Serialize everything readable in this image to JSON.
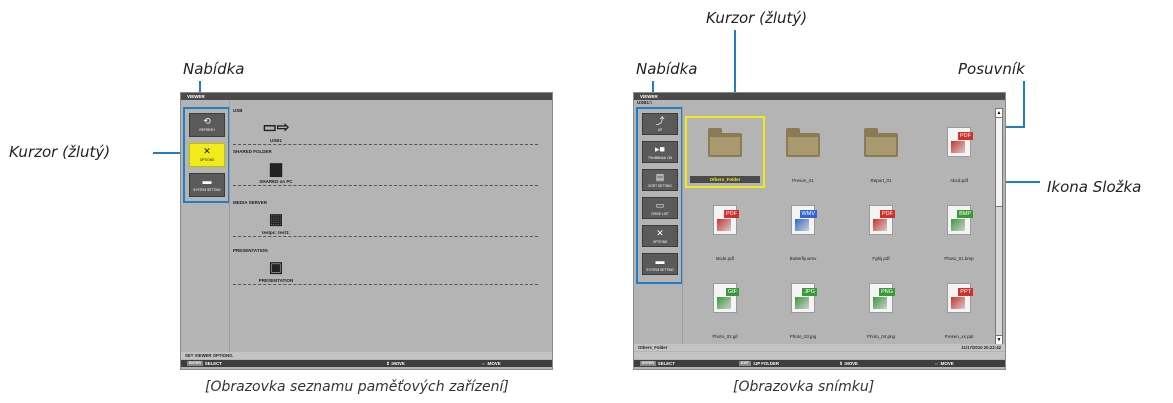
{
  "annotations": {
    "left_menu_label": "Nabídka",
    "left_cursor_label": "Kurzor (žlutý)",
    "right_cursor_label": "Kurzor (žlutý)",
    "right_menu_label": "Nabídka",
    "scrollbar_label": "Posuvník",
    "folder_icon_label": "Ikona Složka"
  },
  "captions": {
    "left": "[Obrazovka seznamu paměťových zařízení]",
    "right": "[Obrazovka snímku]"
  },
  "left_screen": {
    "title": "VIEWER",
    "menu": [
      {
        "icon": "refresh-icon",
        "glyph": "⟲",
        "label": "REFRESH",
        "selected": false
      },
      {
        "icon": "tools-icon",
        "glyph": "✕",
        "label": "OPTIONS",
        "selected": true
      },
      {
        "icon": "system-setting-icon",
        "glyph": "▬",
        "label": "SYSTEM SETTING",
        "selected": false
      }
    ],
    "sections": [
      {
        "header": "USB",
        "device": "USB1",
        "icon": "usb-icon",
        "glyph": "▭⇨"
      },
      {
        "header": "SHARED FOLDER",
        "device": "SHARED on PC",
        "icon": "shared-folder-icon",
        "glyph": "▆"
      },
      {
        "header": "MEDIA SERVER",
        "device": "testpc: test1:",
        "icon": "media-server-icon",
        "glyph": "▦"
      },
      {
        "header": "PRESENTATION",
        "device": "PRESENTATION",
        "icon": "presentation-icon",
        "glyph": "▣"
      }
    ],
    "status": "SET VIEWER OPTIONS.",
    "footer": {
      "enter_key": "ENTER",
      "select": "SELECT",
      "move1": ":MOVE",
      "move2": ":MOVE"
    }
  },
  "right_screen": {
    "title": "VIEWER",
    "path": "USB1:\\",
    "menu": [
      {
        "icon": "up-icon",
        "glyph": "⤴",
        "label": "UP"
      },
      {
        "icon": "thumbnail-icon",
        "glyph": "▸■",
        "label": "THUMBNAIL ON"
      },
      {
        "icon": "sort-icon",
        "glyph": "▤",
        "label": "SORT SETTING"
      },
      {
        "icon": "drive-list-icon",
        "glyph": "▭",
        "label": "DRIVE LIST"
      },
      {
        "icon": "tools-icon",
        "glyph": "✕",
        "label": "OPTIONS"
      },
      {
        "icon": "system-setting-icon",
        "glyph": "▬",
        "label": "SYSTEM SETTING"
      }
    ],
    "files": [
      {
        "name": "Others_Folder",
        "kind": "folder",
        "tag": "",
        "selected": true
      },
      {
        "name": "Preson_01",
        "kind": "folder",
        "tag": "",
        "selected": false
      },
      {
        "name": "Report_01",
        "kind": "folder",
        "tag": "",
        "selected": false
      },
      {
        "name": "Abcd.pdf",
        "kind": "doc",
        "tag": "PDF",
        "color": "#d0302b",
        "selected": false
      },
      {
        "name": "Bcde.pdf",
        "kind": "doc",
        "tag": "PDF",
        "color": "#d0302b",
        "selected": false
      },
      {
        "name": "Butterfly.wmv",
        "kind": "doc",
        "tag": "WMV",
        "color": "#3366cc",
        "selected": false
      },
      {
        "name": "Fghij.pdf",
        "kind": "doc",
        "tag": "PDF",
        "color": "#d0302b",
        "selected": false
      },
      {
        "name": "Photo_01.bmp",
        "kind": "doc",
        "tag": "BMP",
        "color": "#3a9a3a",
        "selected": false
      },
      {
        "name": "Photo_02.gif",
        "kind": "doc",
        "tag": "GIF",
        "color": "#3a9a3a",
        "selected": false
      },
      {
        "name": "Photo_03.jpg",
        "kind": "doc",
        "tag": "JPG",
        "color": "#3a9a3a",
        "selected": false
      },
      {
        "name": "Photo_04.png",
        "kind": "doc",
        "tag": "PNG",
        "color": "#3a9a3a",
        "selected": false
      },
      {
        "name": "Presen_xx.ppt",
        "kind": "doc",
        "tag": "PPT",
        "color": "#d0302b",
        "selected": false
      }
    ],
    "status_left": "Others_Folder",
    "status_right": "11/17/2010  20:22:42",
    "footer": {
      "enter_key": "ENTER",
      "select": "SELECT",
      "exit_key": "EXIT",
      "up_folder": ":UP FOLDER",
      "move1": ":MOVE",
      "move2": ":MOVE"
    }
  }
}
